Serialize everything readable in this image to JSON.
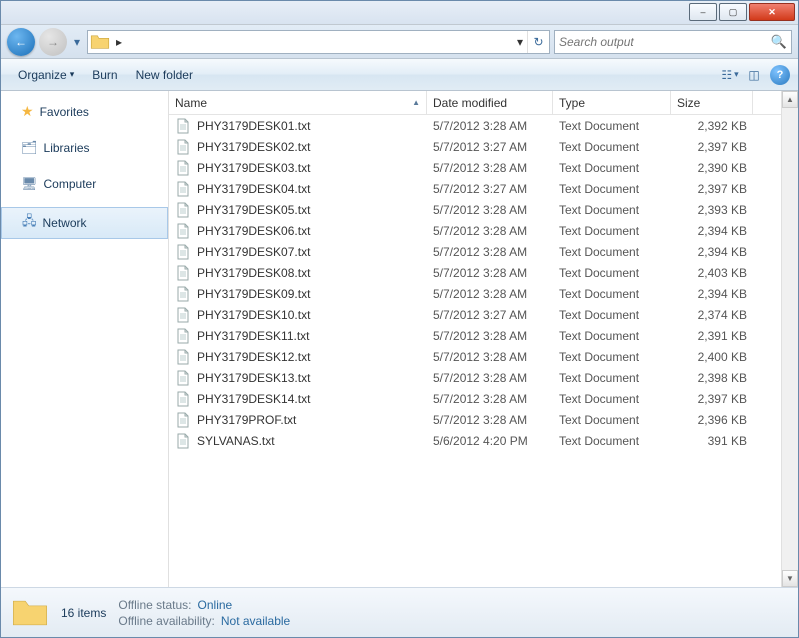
{
  "window": {
    "minimize": "–",
    "maximize": "▢",
    "close": "✕"
  },
  "nav": {
    "breadcrumb_arrow": "▸",
    "refresh": "↻",
    "back": "←",
    "forward": "→",
    "dropdown": "▾"
  },
  "search": {
    "placeholder": "Search output",
    "value": ""
  },
  "toolbar": {
    "organize": "Organize",
    "organize_arrow": "▾",
    "burn": "Burn",
    "new_folder": "New folder",
    "view_arrow": "▾",
    "help": "?"
  },
  "navpane": {
    "favorites": "Favorites",
    "libraries": "Libraries",
    "computer": "Computer",
    "network": "Network"
  },
  "columns": {
    "name": "Name",
    "date": "Date modified",
    "type": "Type",
    "size": "Size"
  },
  "files": [
    {
      "name": "PHY3179DESK01.txt",
      "date": "5/7/2012 3:28 AM",
      "type": "Text Document",
      "size": "2,392 KB"
    },
    {
      "name": "PHY3179DESK02.txt",
      "date": "5/7/2012 3:27 AM",
      "type": "Text Document",
      "size": "2,397 KB"
    },
    {
      "name": "PHY3179DESK03.txt",
      "date": "5/7/2012 3:28 AM",
      "type": "Text Document",
      "size": "2,390 KB"
    },
    {
      "name": "PHY3179DESK04.txt",
      "date": "5/7/2012 3:27 AM",
      "type": "Text Document",
      "size": "2,397 KB"
    },
    {
      "name": "PHY3179DESK05.txt",
      "date": "5/7/2012 3:28 AM",
      "type": "Text Document",
      "size": "2,393 KB"
    },
    {
      "name": "PHY3179DESK06.txt",
      "date": "5/7/2012 3:28 AM",
      "type": "Text Document",
      "size": "2,394 KB"
    },
    {
      "name": "PHY3179DESK07.txt",
      "date": "5/7/2012 3:28 AM",
      "type": "Text Document",
      "size": "2,394 KB"
    },
    {
      "name": "PHY3179DESK08.txt",
      "date": "5/7/2012 3:28 AM",
      "type": "Text Document",
      "size": "2,403 KB"
    },
    {
      "name": "PHY3179DESK09.txt",
      "date": "5/7/2012 3:28 AM",
      "type": "Text Document",
      "size": "2,394 KB"
    },
    {
      "name": "PHY3179DESK10.txt",
      "date": "5/7/2012 3:27 AM",
      "type": "Text Document",
      "size": "2,374 KB"
    },
    {
      "name": "PHY3179DESK11.txt",
      "date": "5/7/2012 3:28 AM",
      "type": "Text Document",
      "size": "2,391 KB"
    },
    {
      "name": "PHY3179DESK12.txt",
      "date": "5/7/2012 3:28 AM",
      "type": "Text Document",
      "size": "2,400 KB"
    },
    {
      "name": "PHY3179DESK13.txt",
      "date": "5/7/2012 3:28 AM",
      "type": "Text Document",
      "size": "2,398 KB"
    },
    {
      "name": "PHY3179DESK14.txt",
      "date": "5/7/2012 3:28 AM",
      "type": "Text Document",
      "size": "2,397 KB"
    },
    {
      "name": "PHY3179PROF.txt",
      "date": "5/7/2012 3:28 AM",
      "type": "Text Document",
      "size": "2,396 KB"
    },
    {
      "name": "SYLVANAS.txt",
      "date": "5/6/2012 4:20 PM",
      "type": "Text Document",
      "size": "391 KB"
    }
  ],
  "status": {
    "count": "16 items",
    "offline_status_label": "Offline status:",
    "offline_status_value": "Online",
    "offline_avail_label": "Offline availability:",
    "offline_avail_value": "Not available"
  }
}
